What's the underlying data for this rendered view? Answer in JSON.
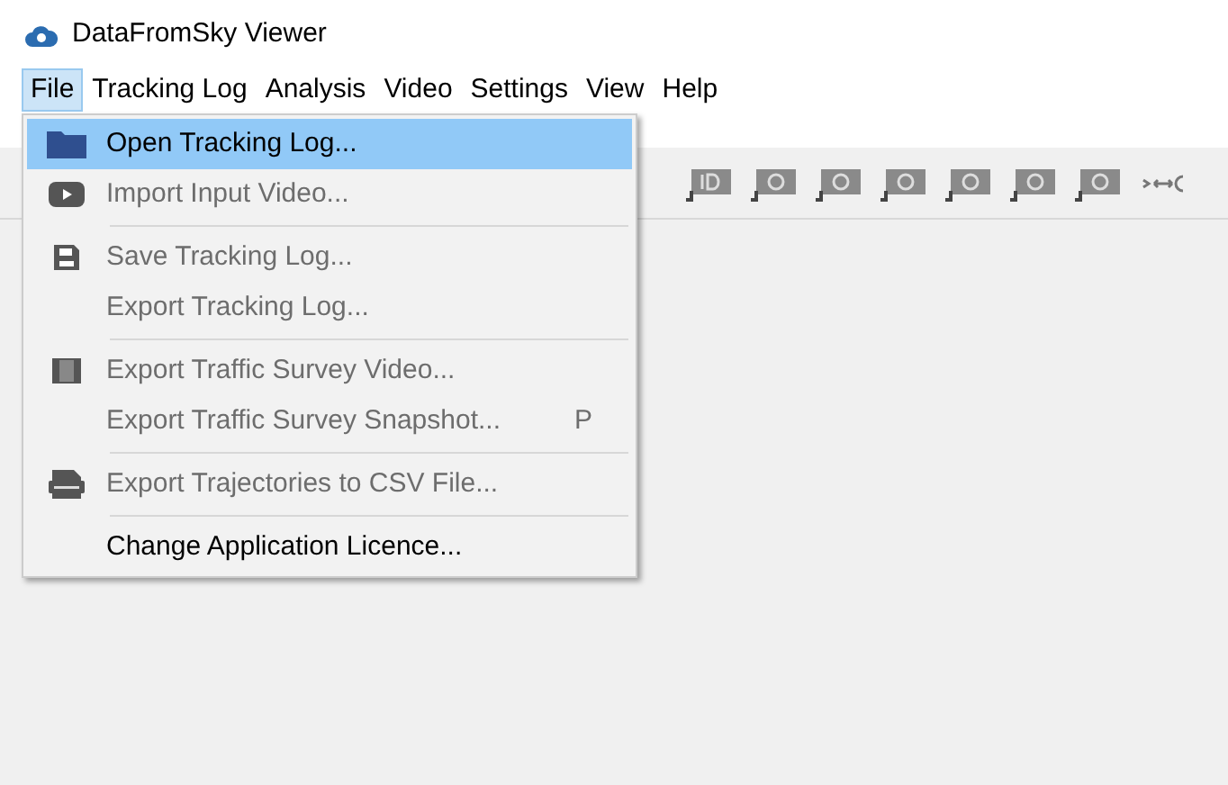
{
  "window": {
    "title": "DataFromSky Viewer"
  },
  "menu_bar": [
    {
      "label": "File",
      "selected": true
    },
    {
      "label": "Tracking Log",
      "selected": false
    },
    {
      "label": "Analysis",
      "selected": false
    },
    {
      "label": "Video",
      "selected": false
    },
    {
      "label": "Settings",
      "selected": false
    },
    {
      "label": "View",
      "selected": false
    },
    {
      "label": "Help",
      "selected": false
    }
  ],
  "file_menu": [
    {
      "kind": "folder",
      "label": "Open Tracking Log...",
      "disabled": false,
      "selected": true
    },
    {
      "kind": "play",
      "label": "Import Input Video...",
      "disabled": true,
      "selected": false
    },
    {
      "kind": "separator"
    },
    {
      "kind": "disk",
      "label": "Save Tracking Log...",
      "disabled": true,
      "selected": false
    },
    {
      "kind": "plain",
      "label": "Export Tracking Log...",
      "disabled": true,
      "selected": false
    },
    {
      "kind": "separator"
    },
    {
      "kind": "film",
      "label": "Export Traffic Survey Video...",
      "disabled": true,
      "selected": false
    },
    {
      "kind": "plain",
      "label": "Export Traffic Survey Snapshot...",
      "shortcut": "P",
      "disabled": true,
      "selected": false
    },
    {
      "kind": "separator"
    },
    {
      "kind": "csv",
      "label": "Export Trajectories to CSV File...",
      "disabled": true,
      "selected": false
    },
    {
      "kind": "separator"
    },
    {
      "kind": "plain",
      "label": "Change Application Licence...",
      "disabled": false,
      "selected": false
    }
  ]
}
